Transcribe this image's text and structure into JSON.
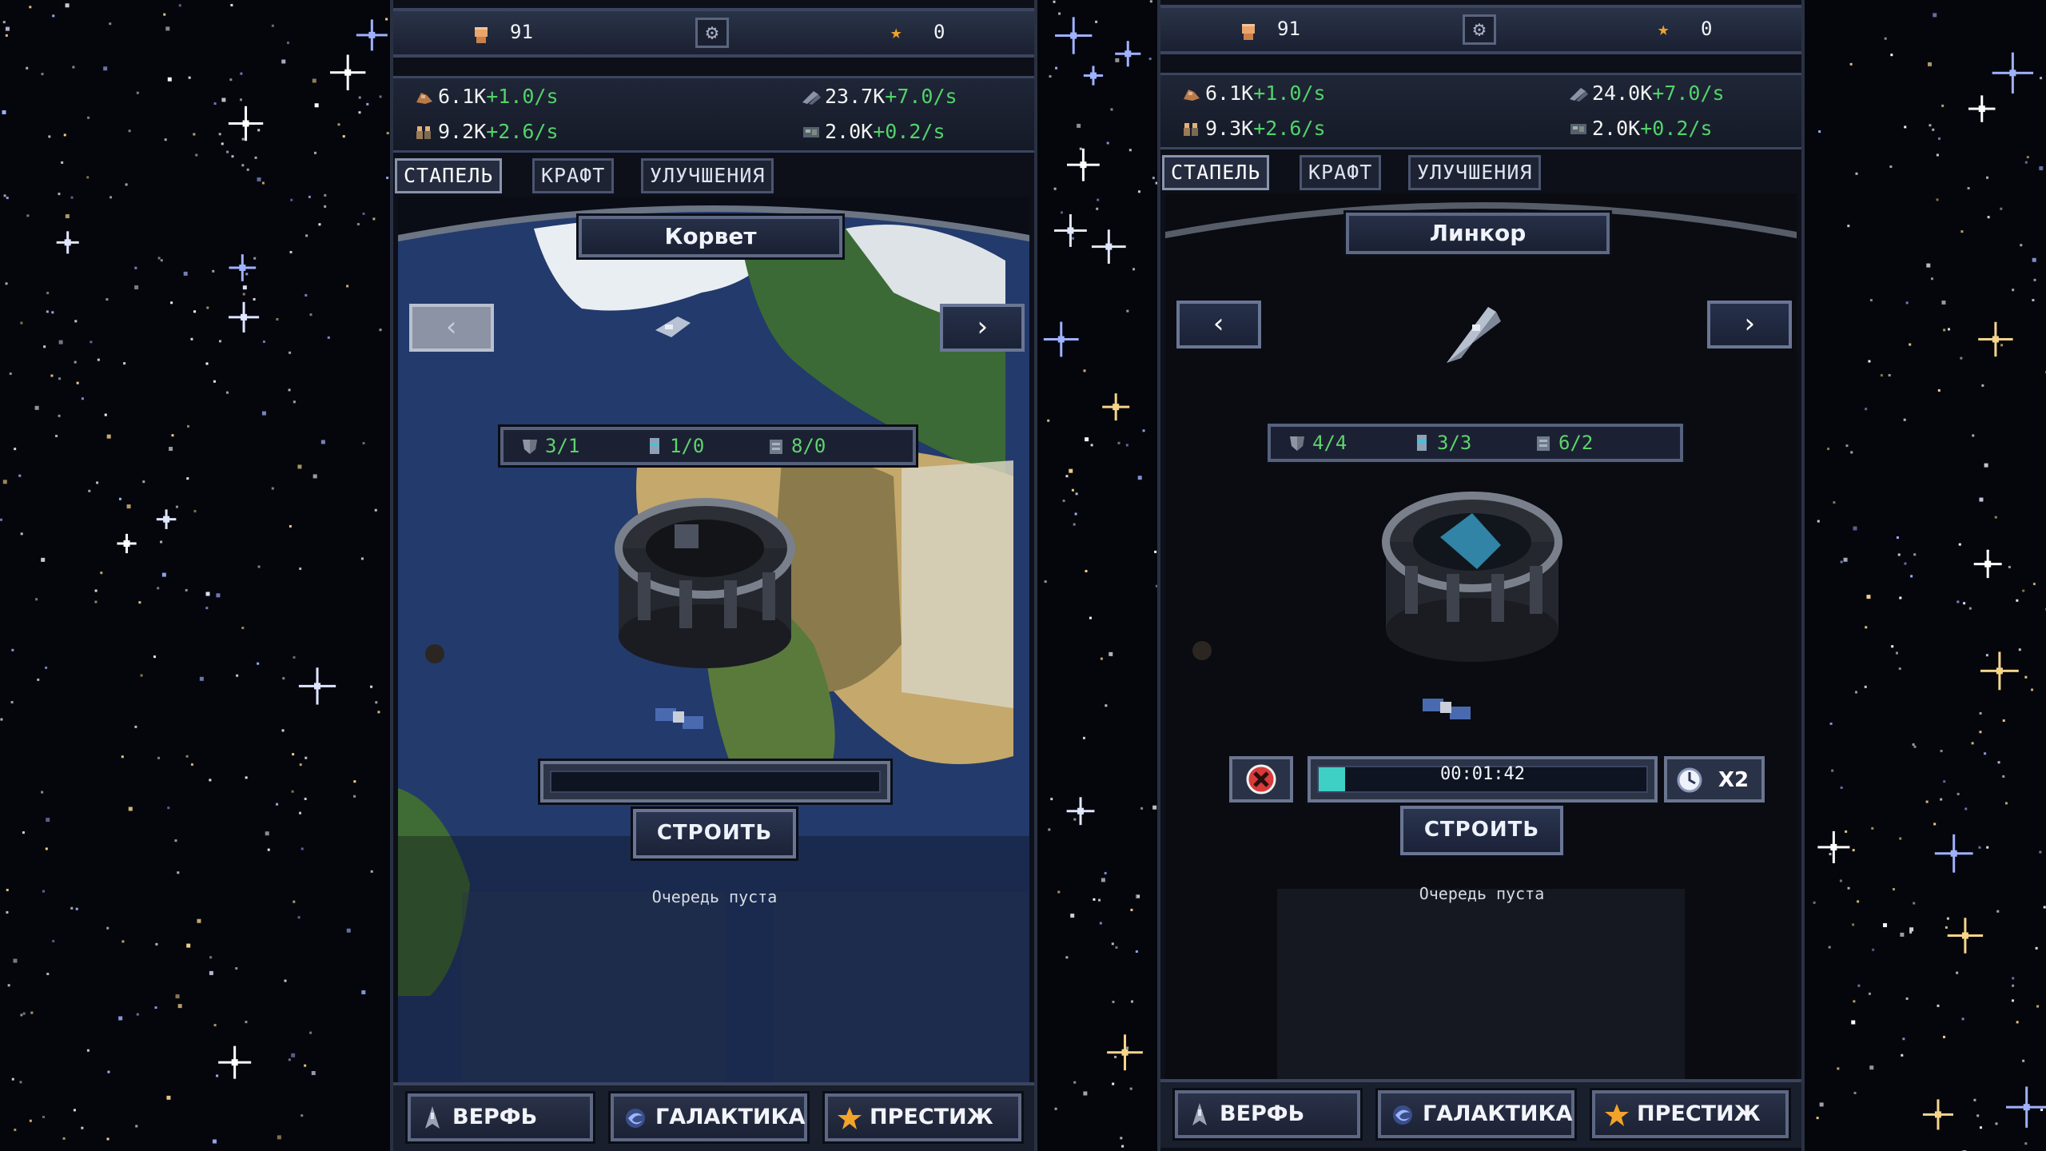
{
  "colors": {
    "background": "#05060c",
    "panel": "#0d1018",
    "rate_green": "#52d36a",
    "progress_cyan": "#3fd0c5",
    "star_orange": "#f2a32a"
  },
  "left": {
    "topbar": {
      "fist_count": "91",
      "stars": "0"
    },
    "resources": [
      {
        "icon": "ore-icon",
        "amount": "6.1K",
        "rate": "+1.0/s"
      },
      {
        "icon": "alloy-icon",
        "amount": "23.7K",
        "rate": "+7.0/s"
      },
      {
        "icon": "crew-icon",
        "amount": "9.2K",
        "rate": "+2.6/s"
      },
      {
        "icon": "tech-icon",
        "amount": "2.0K",
        "rate": "+0.2/s"
      }
    ],
    "tabs": [
      "СТАПЕЛЬ",
      "КРАФТ",
      "УЛУЧШЕНИЯ"
    ],
    "active_tab": "СТАПЕЛЬ",
    "ship_name": "Корвет",
    "requirements": [
      {
        "icon": "armor-icon",
        "value": "3/1"
      },
      {
        "icon": "fuel-icon",
        "value": "1/0"
      },
      {
        "icon": "module-icon",
        "value": "8/0"
      }
    ],
    "prev_disabled": true,
    "build_label": "СТРОИТЬ",
    "queue_text": "Очередь пуста",
    "nav": [
      "ВЕРФЬ",
      "ГАЛАКТИКА",
      "ПРЕСТИЖ"
    ]
  },
  "right": {
    "topbar": {
      "fist_count": "91",
      "stars": "0"
    },
    "resources": [
      {
        "icon": "ore-icon",
        "amount": "6.1K",
        "rate": "+1.0/s"
      },
      {
        "icon": "alloy-icon",
        "amount": "24.0K",
        "rate": "+7.0/s"
      },
      {
        "icon": "crew-icon",
        "amount": "9.3K",
        "rate": "+2.6/s"
      },
      {
        "icon": "tech-icon",
        "amount": "2.0K",
        "rate": "+0.2/s"
      }
    ],
    "tabs": [
      "СТАПЕЛЬ",
      "КРАФТ",
      "УЛУЧШЕНИЯ"
    ],
    "active_tab": "СТАПЕЛЬ",
    "ship_name": "Линкор",
    "requirements": [
      {
        "icon": "armor-icon",
        "value": "4/4"
      },
      {
        "icon": "fuel-icon",
        "value": "3/3"
      },
      {
        "icon": "module-icon",
        "value": "6/2"
      }
    ],
    "prev_disabled": false,
    "timer": "00:01:42",
    "progress": 0.08,
    "speedup_label": "X2",
    "build_label": "СТРОИТЬ",
    "queue_text": "Очередь пуста",
    "nav": [
      "ВЕРФЬ",
      "ГАЛАКТИКА",
      "ПРЕСТИЖ"
    ]
  }
}
